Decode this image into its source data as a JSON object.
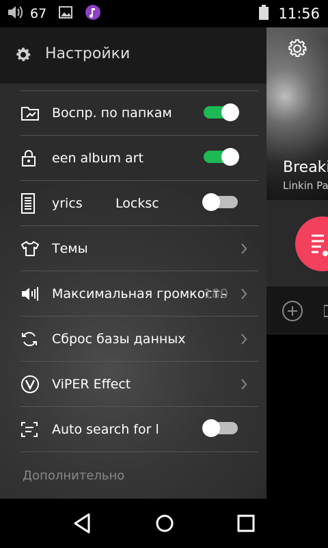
{
  "status_bar": {
    "volume_level": "67",
    "time": "11:56",
    "icons": [
      "volume-icon",
      "image-icon",
      "music-app-icon",
      "battery-icon"
    ]
  },
  "drawer": {
    "title": "Настройки",
    "items": [
      {
        "icon": "folder-play-icon",
        "label": "Воспр. по папкам",
        "control": "toggle",
        "on": true
      },
      {
        "icon": "lock-icon",
        "label": "een album art",
        "control": "toggle",
        "on": true
      },
      {
        "icon": "lyrics-icon",
        "label": "yrics        Locksc",
        "control": "toggle",
        "on": false
      },
      {
        "icon": "tshirt-icon",
        "label": "Темы",
        "control": "chevron"
      },
      {
        "icon": "volume-max-icon",
        "label": "Максимальная громкость",
        "value": "180",
        "control": "chevron"
      },
      {
        "icon": "refresh-icon",
        "label": "Сброс базы данных",
        "control": "chevron"
      },
      {
        "icon": "viper-icon",
        "label": "ViPER Effect",
        "control": "chevron"
      },
      {
        "icon": "scan-icon",
        "label": "Auto search for l",
        "control": "toggle",
        "on": false
      }
    ],
    "section_label": "Дополнительно"
  },
  "now_playing": {
    "title": "Breaking",
    "artist": "Linkin Park"
  },
  "colors": {
    "toggle_on": "#1db954",
    "fab": "#f2405d"
  }
}
